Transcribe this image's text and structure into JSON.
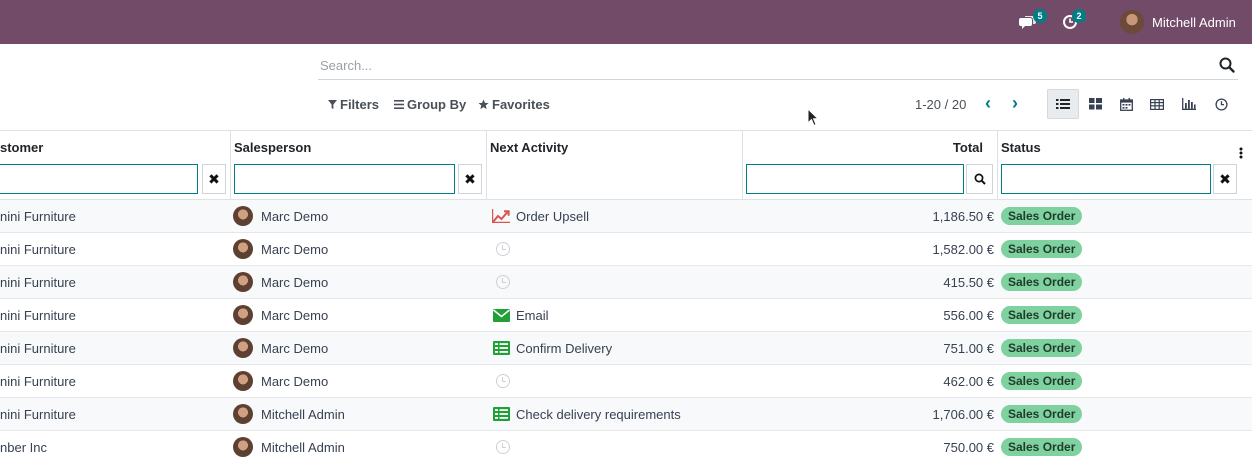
{
  "topbar": {
    "messages_count": "5",
    "activities_count": "2",
    "user_name": "Mitchell Admin"
  },
  "search": {
    "placeholder": "Search..."
  },
  "filters": {
    "filters_label": "Filters",
    "group_by_label": "Group By",
    "favorites_label": "Favorites"
  },
  "pager": {
    "value": "1-20 / 20"
  },
  "views": [
    "list-view",
    "kanban-view",
    "calendar-view",
    "pivot-view",
    "graph-view",
    "activity-view"
  ],
  "table": {
    "headers": {
      "customer": "stomer",
      "salesperson": "Salesperson",
      "next_activity": "Next Activity",
      "total": "Total",
      "status": "Status"
    },
    "rows": [
      {
        "customer": "nini Furniture",
        "salesperson": "Marc Demo",
        "activity": "Order Upsell",
        "activity_icon": "trending-up-icon",
        "total": "1,186.50 €",
        "status": "Sales Order"
      },
      {
        "customer": "nini Furniture",
        "salesperson": "Marc Demo",
        "activity": "",
        "activity_icon": "clock-icon",
        "total": "1,582.00 €",
        "status": "Sales Order"
      },
      {
        "customer": "nini Furniture",
        "salesperson": "Marc Demo",
        "activity": "",
        "activity_icon": "clock-icon",
        "total": "415.50 €",
        "status": "Sales Order"
      },
      {
        "customer": "nini Furniture",
        "salesperson": "Marc Demo",
        "activity": "Email",
        "activity_icon": "envelope-icon",
        "total": "556.00 €",
        "status": "Sales Order"
      },
      {
        "customer": "nini Furniture",
        "salesperson": "Marc Demo",
        "activity": "Confirm Delivery",
        "activity_icon": "tasks-icon",
        "total": "751.00 €",
        "status": "Sales Order"
      },
      {
        "customer": "nini Furniture",
        "salesperson": "Marc Demo",
        "activity": "",
        "activity_icon": "clock-icon",
        "total": "462.00 €",
        "status": "Sales Order"
      },
      {
        "customer": "nini Furniture",
        "salesperson": "Mitchell Admin",
        "activity": "Check delivery requirements",
        "activity_icon": "tasks-icon",
        "total": "1,706.00 €",
        "status": "Sales Order"
      },
      {
        "customer": "nber Inc",
        "salesperson": "Mitchell Admin",
        "activity": "",
        "activity_icon": "clock-icon",
        "total": "750.00 €",
        "status": "Sales Order"
      }
    ]
  },
  "colors": {
    "brand": "#714b67",
    "accent": "#017e84",
    "status_badge": "#7fd1a0",
    "upsell_icon": "#d9534f",
    "email_icon": "#21a038",
    "tasks_icon": "#21a038"
  }
}
